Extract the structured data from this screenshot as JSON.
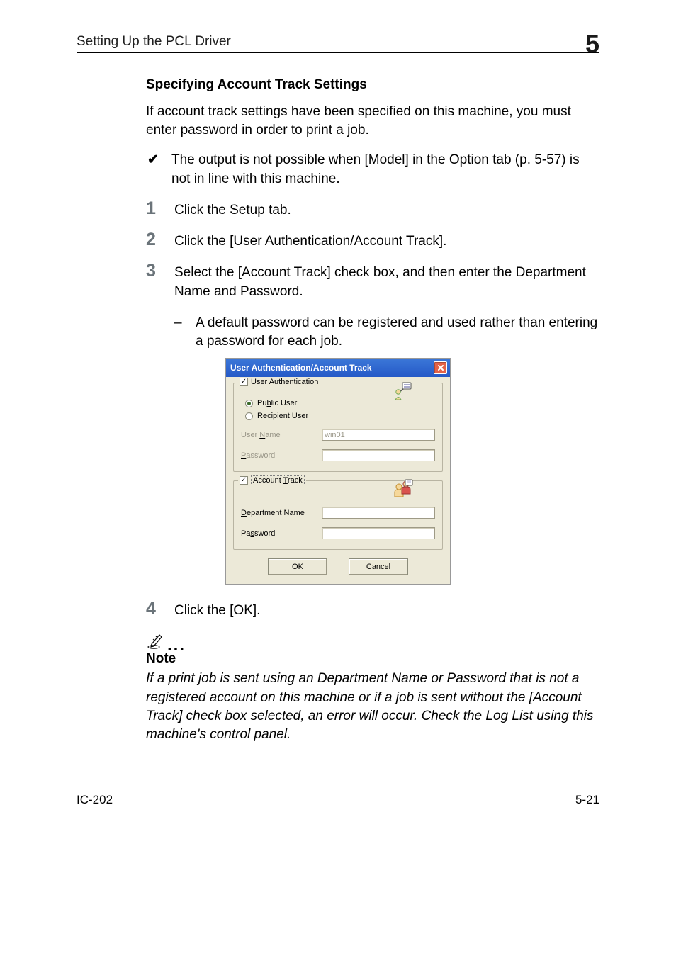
{
  "header": {
    "section_path": "Setting Up the PCL Driver",
    "chapter_number": "5"
  },
  "sec_title": "Specifying Account Track Settings",
  "intro_text": "If account track settings have been specified on this machine, you must enter password in order to print a job.",
  "check_item": "The output is not possible when [Model] in the Option tab (p. 5-57) is not in line with this machine.",
  "steps": {
    "n1": {
      "num": "1",
      "text": "Click the Setup tab."
    },
    "n2": {
      "num": "2",
      "text": "Click the [User Authentication/Account Track]."
    },
    "n3": {
      "num": "3",
      "text": "Select the [Account Track] check box, and then enter the Department Name and Password."
    },
    "n3_sub": "A default password can be registered and used rather than entering a password for each job.",
    "n4": {
      "num": "4",
      "text": "Click the [OK]."
    }
  },
  "dialog": {
    "title": "User Authentication/Account Track",
    "user_auth": {
      "title_pre": "User ",
      "title_key": "A",
      "title_post": "uthentication",
      "public_user_pre": "Pu",
      "public_user_key": "b",
      "public_user_post": "lic User",
      "recipient_user_key": "R",
      "recipient_user_post": "ecipient User",
      "user_name_label_pre": "User ",
      "user_name_label_key": "N",
      "user_name_label_post": "ame",
      "user_name_value": "win01",
      "password_label_key": "P",
      "password_label_post": "assword",
      "password_value": ""
    },
    "account_track": {
      "title_pre": "Account ",
      "title_key": "T",
      "title_post": "rack",
      "dept_key": "D",
      "dept_post": "epartment Name",
      "dept_value": "",
      "pw_pre": "Pa",
      "pw_key": "s",
      "pw_post": "sword",
      "pw_value": ""
    },
    "ok_label": "OK",
    "cancel_label": "Cancel"
  },
  "note": {
    "label": "Note",
    "body": "If a print job is sent using an Department Name or Password that is not a registered account on this machine or if a job is sent without the [Account Track] check box selected, an error will occur. Check the Log List using this machine's control panel."
  },
  "footer": {
    "model": "IC-202",
    "page": "5-21"
  }
}
